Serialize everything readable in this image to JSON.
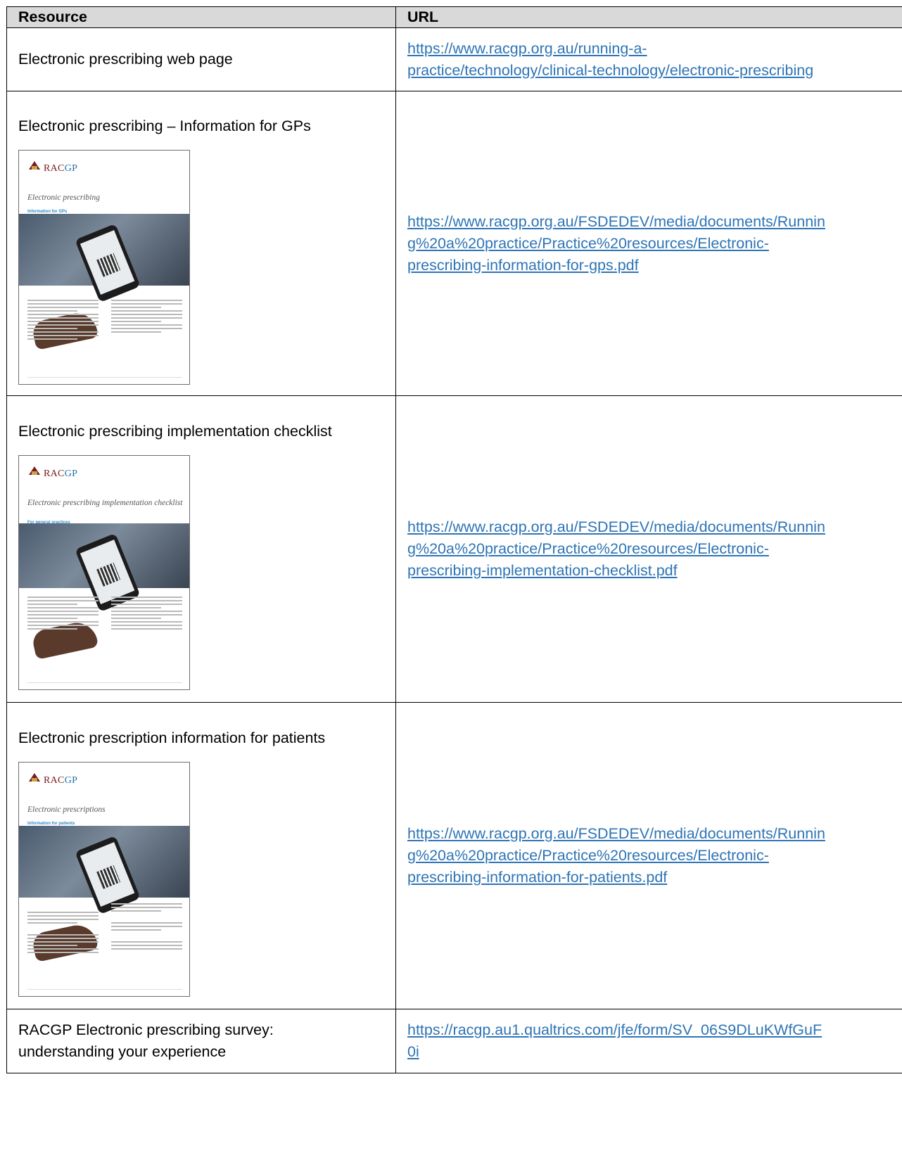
{
  "table": {
    "headers": {
      "resource": "Resource",
      "url": "URL"
    },
    "rows": [
      {
        "resource": "Electronic prescribing web page",
        "url": "https://www.racgp.org.au/running-a-\npractice/technology/clinical-technology/electronic-prescribing"
      },
      {
        "resource": "Electronic prescribing – Information for GPs",
        "url": "https://www.racgp.org.au/FSDEDEV/media/documents/Runnin\ng%20a%20practice/Practice%20resources/Electronic-\nprescribing-information-for-gps.pdf",
        "thumbnail": {
          "brand_a": "RAC",
          "brand_b": "GP",
          "title": "Electronic prescribing",
          "subtitle": "Information for GPs"
        }
      },
      {
        "resource": "Electronic prescribing implementation checklist",
        "url": "https://www.racgp.org.au/FSDEDEV/media/documents/Runnin\ng%20a%20practice/Practice%20resources/Electronic-\nprescribing-implementation-checklist.pdf",
        "thumbnail": {
          "brand_a": "RAC",
          "brand_b": "GP",
          "title": "Electronic prescribing implementation checklist",
          "subtitle": "For general practices"
        }
      },
      {
        "resource": "Electronic prescription information for patients",
        "url": "https://www.racgp.org.au/FSDEDEV/media/documents/Runnin\ng%20a%20practice/Practice%20resources/Electronic-\nprescribing-information-for-patients.pdf",
        "thumbnail": {
          "brand_a": "RAC",
          "brand_b": "GP",
          "title": "Electronic prescriptions",
          "subtitle": "Information for patients"
        }
      },
      {
        "resource": "RACGP Electronic prescribing survey: understanding your experience",
        "url": "https://racgp.au1.qualtrics.com/jfe/form/SV_06S9DLuKWfGuF\n0i"
      }
    ]
  },
  "colors": {
    "header_bg": "#d9d9d9",
    "link": "#2e74b5",
    "border": "#000000"
  }
}
